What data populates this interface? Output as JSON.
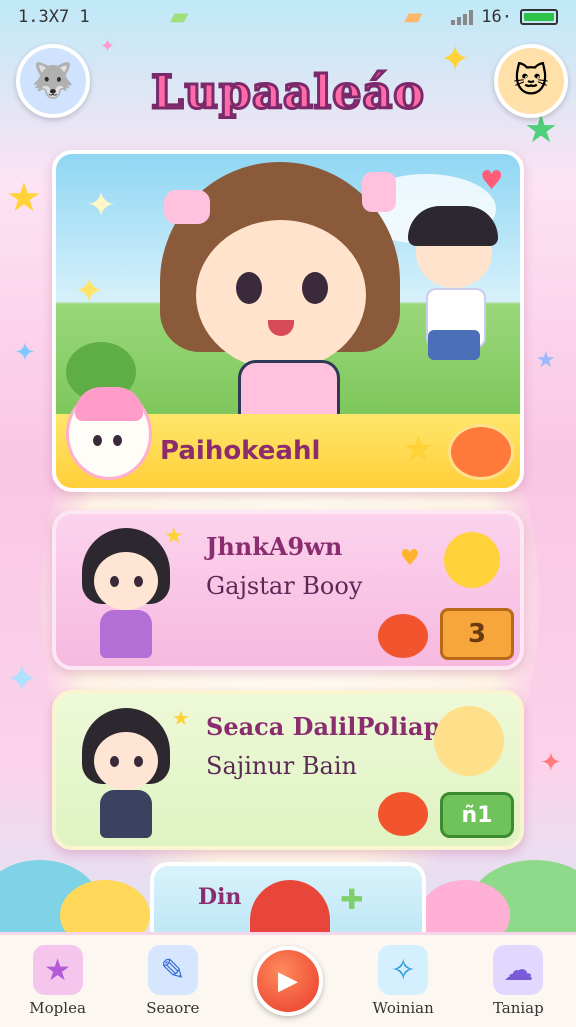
{
  "status_bar": {
    "time": "1.3X7 1"
  },
  "header": {
    "title": "Lupaaleáo"
  },
  "hero_card": {
    "label": "Paihokeahl"
  },
  "card_2": {
    "title": "JhnkA9wn",
    "subtitle": "Gajstar Booy",
    "badge": "3"
  },
  "card_3": {
    "title": "Seaca DalilPoliap",
    "subtitle": "Sajinur Bain",
    "button": "ñ1"
  },
  "peek_card": {
    "label": "Din"
  },
  "tab_bar": {
    "items": [
      {
        "label": "Moplea",
        "icon": "star-creature-icon"
      },
      {
        "label": "Seaore",
        "icon": "scroll-icon"
      },
      {
        "label": "",
        "icon": "play-icon"
      },
      {
        "label": "Woinian",
        "icon": "magic-wand-icon"
      },
      {
        "label": "Taniap",
        "icon": "cloud-creature-icon"
      }
    ]
  },
  "colors": {
    "title_pink": "#ff6aa8",
    "accent_yellow": "#ffd93a",
    "card_pink": "#f7b9e0",
    "card_green": "#dff3c2"
  }
}
